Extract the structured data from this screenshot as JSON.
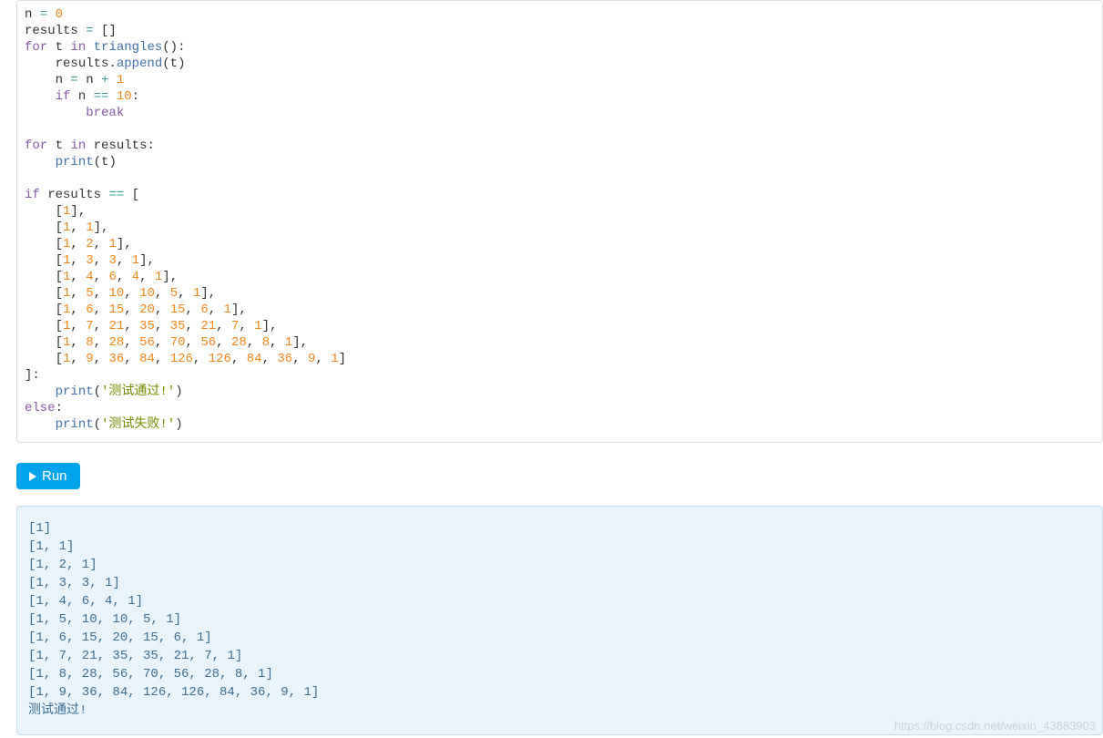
{
  "code": {
    "lines": [
      {
        "type": "assign",
        "target": "n",
        "value_num": "0"
      },
      {
        "type": "assign_raw",
        "target": "results",
        "value": "[]"
      },
      {
        "type": "for_call",
        "var": "t",
        "fn": "triangles"
      },
      {
        "type": "method_call",
        "indent": 1,
        "obj": "results",
        "method": "append",
        "arg_id": "t"
      },
      {
        "type": "assign_expr",
        "indent": 1,
        "target": "n",
        "lhs": "n",
        "op": "+",
        "rhs_num": "1"
      },
      {
        "type": "if_eq",
        "indent": 1,
        "lhs": "n",
        "rhs_num": "10"
      },
      {
        "type": "kw",
        "indent": 2,
        "word": "break"
      },
      {
        "type": "blank"
      },
      {
        "type": "for_in",
        "var": "t",
        "iter": "results"
      },
      {
        "type": "call",
        "indent": 1,
        "fn": "print",
        "arg_id": "t"
      },
      {
        "type": "blank"
      },
      {
        "type": "if_eq_open",
        "lhs": "results",
        "open": "["
      },
      {
        "type": "listline",
        "indent": 1,
        "text": "[1],",
        "nums": [
          "1"
        ]
      },
      {
        "type": "listline",
        "indent": 1,
        "text": "[1, 1],",
        "nums": [
          "1",
          "1"
        ]
      },
      {
        "type": "listline",
        "indent": 1,
        "text": "[1, 2, 1],",
        "nums": [
          "1",
          "2",
          "1"
        ]
      },
      {
        "type": "listline",
        "indent": 1,
        "text": "[1, 3, 3, 1],",
        "nums": [
          "1",
          "3",
          "3",
          "1"
        ]
      },
      {
        "type": "listline",
        "indent": 1,
        "text": "[1, 4, 6, 4, 1],",
        "nums": [
          "1",
          "4",
          "6",
          "4",
          "1"
        ]
      },
      {
        "type": "listline",
        "indent": 1,
        "text": "[1, 5, 10, 10, 5, 1],",
        "nums": [
          "1",
          "5",
          "10",
          "10",
          "5",
          "1"
        ]
      },
      {
        "type": "listline",
        "indent": 1,
        "text": "[1, 6, 15, 20, 15, 6, 1],",
        "nums": [
          "1",
          "6",
          "15",
          "20",
          "15",
          "6",
          "1"
        ]
      },
      {
        "type": "listline",
        "indent": 1,
        "text": "[1, 7, 21, 35, 35, 21, 7, 1],",
        "nums": [
          "1",
          "7",
          "21",
          "35",
          "35",
          "21",
          "7",
          "1"
        ]
      },
      {
        "type": "listline",
        "indent": 1,
        "text": "[1, 8, 28, 56, 70, 56, 28, 8, 1],",
        "nums": [
          "1",
          "8",
          "28",
          "56",
          "70",
          "56",
          "28",
          "8",
          "1"
        ]
      },
      {
        "type": "listline",
        "indent": 1,
        "text": "[1, 9, 36, 84, 126, 126, 84, 36, 9, 1]",
        "nums": [
          "1",
          "9",
          "36",
          "84",
          "126",
          "126",
          "84",
          "36",
          "9",
          "1"
        ]
      },
      {
        "type": "close_colon",
        "text": "]:"
      },
      {
        "type": "call",
        "indent": 1,
        "fn": "print",
        "arg_str": "'测试通过!'"
      },
      {
        "type": "else"
      },
      {
        "type": "call",
        "indent": 1,
        "fn": "print",
        "arg_str": "'测试失败!'"
      }
    ]
  },
  "run_button": "Run",
  "output": {
    "lines": [
      "[1]",
      "[1, 1]",
      "[1, 2, 1]",
      "[1, 3, 3, 1]",
      "[1, 4, 6, 4, 1]",
      "[1, 5, 10, 10, 5, 1]",
      "[1, 6, 15, 20, 15, 6, 1]",
      "[1, 7, 21, 35, 35, 21, 7, 1]",
      "[1, 8, 28, 56, 70, 56, 28, 8, 1]",
      "[1, 9, 36, 84, 126, 126, 84, 36, 9, 1]",
      "测试通过!"
    ]
  },
  "watermark": "https://blog.csdn.net/weixin_43883903"
}
